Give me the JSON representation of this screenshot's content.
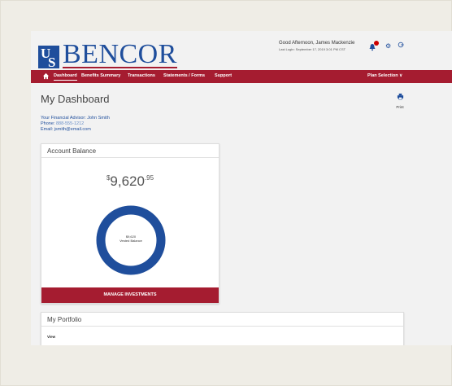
{
  "logo": {
    "text": "BENCOR",
    "u": "U",
    "s": "S"
  },
  "user": {
    "greeting": "Good Afternoon, James Mackenzie",
    "last_login": "Last Login: September 17, 2019 3:01 PM CST"
  },
  "nav": {
    "items": [
      {
        "label": "Dashboard",
        "active": true
      },
      {
        "label": "Benefits Summary"
      },
      {
        "label": "Transactions"
      },
      {
        "label": "Statements / Forms"
      },
      {
        "label": "Support"
      }
    ],
    "plan_selection": "Plan Selection ∨"
  },
  "page": {
    "title": "My Dashboard",
    "print_label": "Print"
  },
  "advisor": {
    "line1": "Your Financial Advisor: John Smith",
    "phone_label": "Phone: ",
    "phone": "888-555-1212",
    "email": "Email: jsmith@email.com"
  },
  "account": {
    "header": "Account Balance",
    "dollar": "$",
    "whole": "9,620",
    "cents": ".95",
    "donut_line1": "$9,620",
    "donut_line2": "Vested Balance",
    "vested_fraction": 1.0,
    "button": "MANAGE INVESTMENTS"
  },
  "portfolio": {
    "header": "My Portfolio",
    "view": "View"
  },
  "colors": {
    "brand_blue": "#1f4e9c",
    "brand_red": "#a51c30"
  }
}
